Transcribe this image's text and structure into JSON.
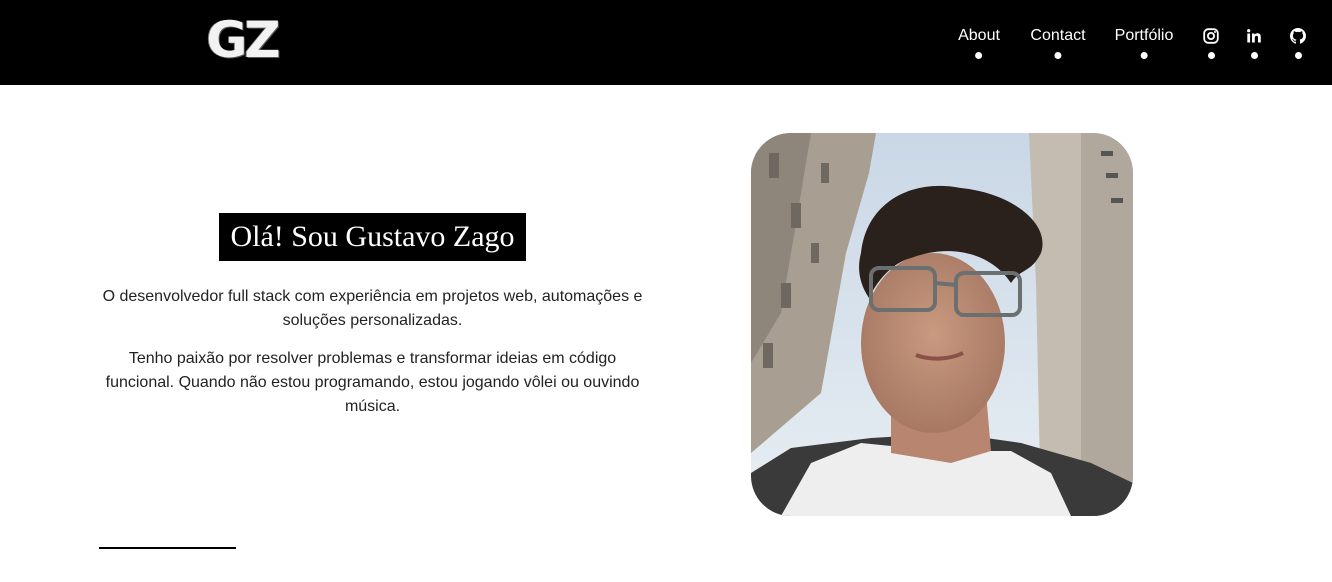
{
  "header": {
    "logo_text": "GZ",
    "nav": [
      {
        "label": "About"
      },
      {
        "label": "Contact"
      },
      {
        "label": "Portfólio"
      }
    ],
    "social_icons": [
      "instagram-icon",
      "linkedin-icon",
      "github-icon"
    ]
  },
  "hero": {
    "title": "Olá! Sou Gustavo Zago",
    "paragraphs": [
      "O desenvolvedor full stack com experiência em projetos web, automações e soluções personalizadas.",
      "Tenho paixão por resolver problemas e transformar ideias em código funcional. Quando não estou programando, estou jogando vôlei ou ouvindo música."
    ]
  },
  "colors": {
    "nav_background": "#000000",
    "page_background": "#ffffff",
    "text": "#222222"
  }
}
